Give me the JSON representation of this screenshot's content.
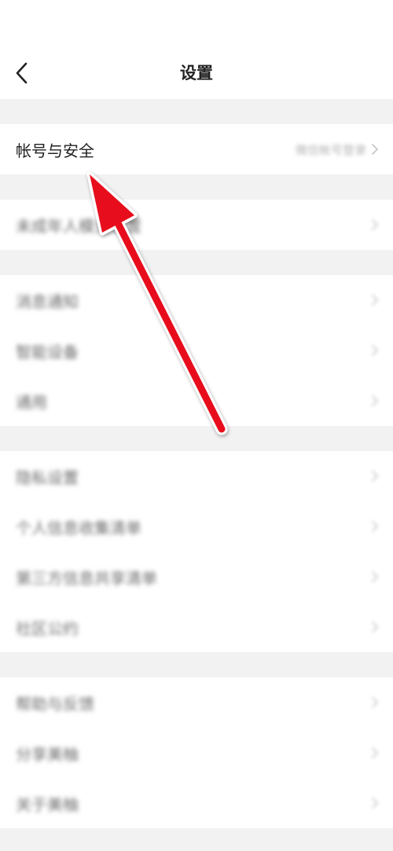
{
  "nav": {
    "title": "设置",
    "back_icon": "chevron-left-icon"
  },
  "groups": [
    {
      "items": [
        {
          "label": "帐号与安全",
          "value": "微信帐号登录"
        }
      ]
    },
    {
      "items": [
        {
          "label": "未成年人模式设置",
          "value": ""
        }
      ]
    },
    {
      "items": [
        {
          "label": "消息通知",
          "value": ""
        },
        {
          "label": "智能设备",
          "value": ""
        },
        {
          "label": "通用",
          "value": ""
        }
      ]
    },
    {
      "items": [
        {
          "label": "隐私设置",
          "value": ""
        },
        {
          "label": "个人信息收集清单",
          "value": ""
        },
        {
          "label": "第三方信息共享清单",
          "value": ""
        },
        {
          "label": "社区公约",
          "value": ""
        }
      ]
    },
    {
      "items": [
        {
          "label": "帮助与反馈",
          "value": ""
        },
        {
          "label": "分享美柚",
          "value": ""
        },
        {
          "label": "关于美柚",
          "value": ""
        }
      ]
    }
  ],
  "annotation": {
    "arrow_color": "#e8101b",
    "icon": "red-pointer-arrow-icon"
  },
  "colors": {
    "background": "#f2f2f2",
    "card": "#ffffff",
    "text": "#222222",
    "muted": "#b3b3b3"
  }
}
